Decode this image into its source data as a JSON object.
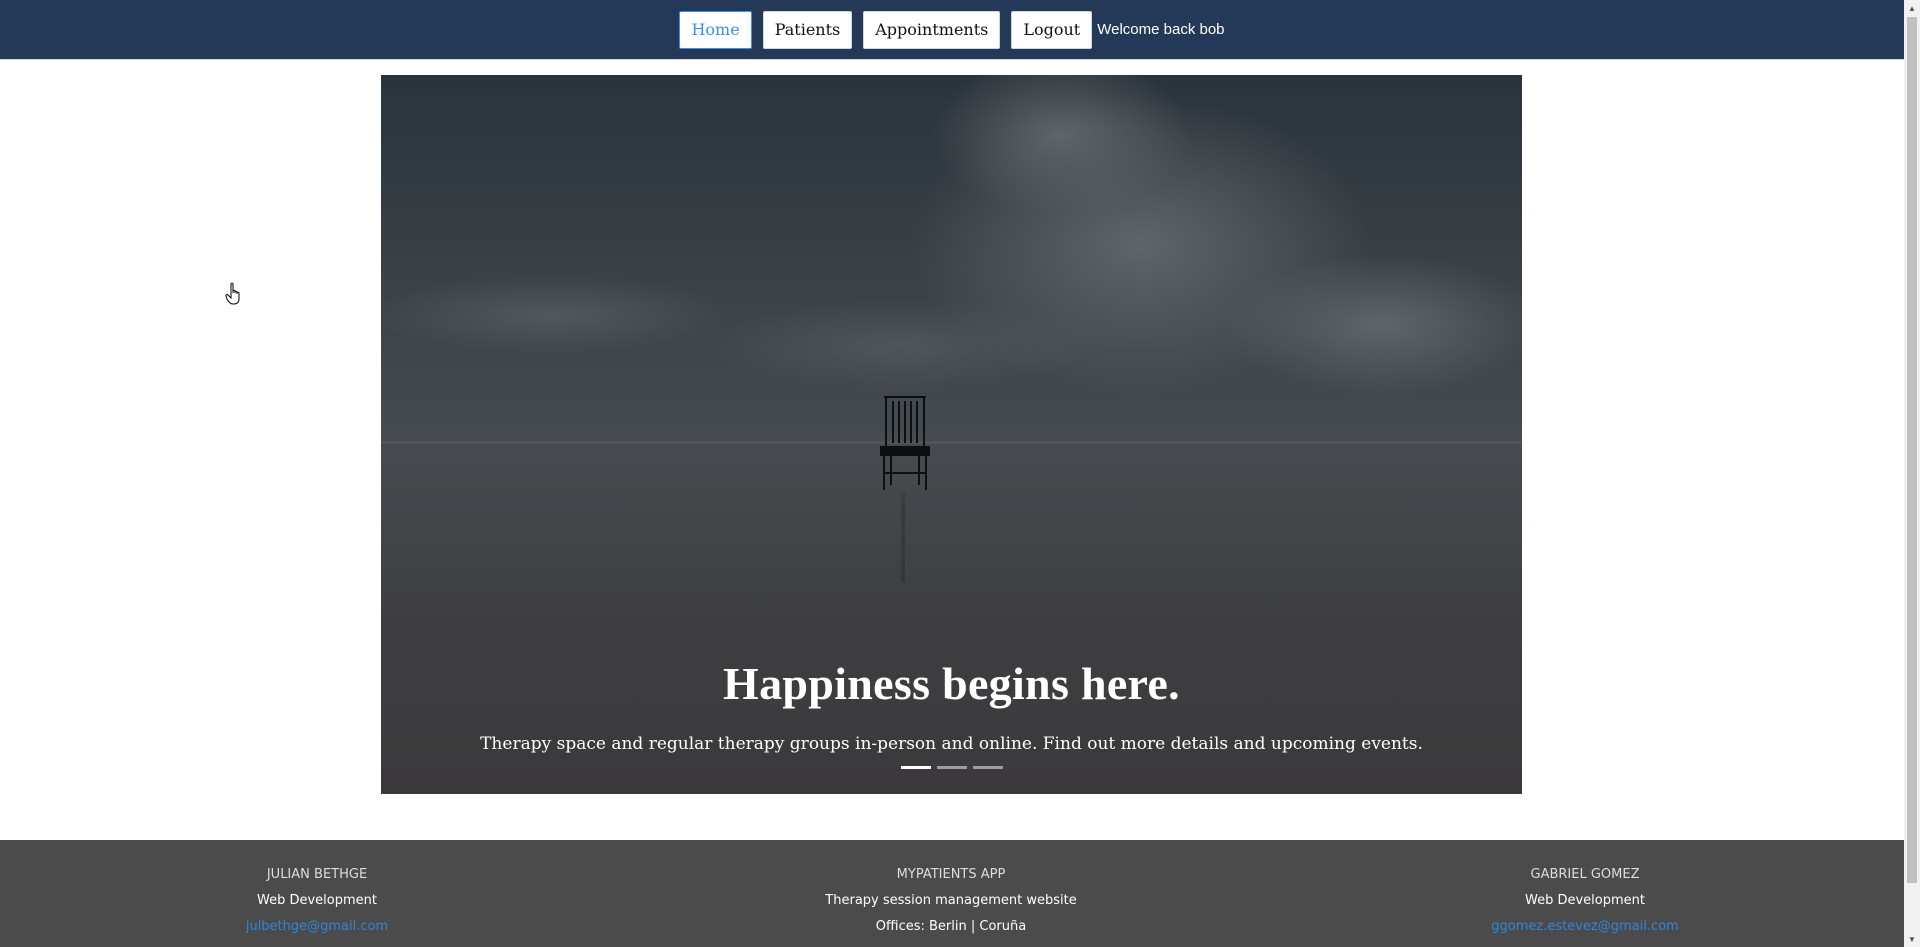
{
  "nav": {
    "home_label": "Home",
    "patients_label": "Patients",
    "appointments_label": "Appointments",
    "logout_label": "Logout",
    "welcome_text": "Welcome back bob",
    "active_color": "#3d8ef0",
    "bar_color": "#243858"
  },
  "hero": {
    "title": "Happiness begins here.",
    "subtitle": "Therapy space and regular therapy groups in-person and online. Find out more details and upcoming events.",
    "slide_count": 3,
    "active_slide": 1
  },
  "footer": {
    "left": {
      "heading": "JULIAN BETHGE",
      "role": "Web Development",
      "email": "julbethge@gmail.com"
    },
    "middle": {
      "heading": "MYPATIENTS APP",
      "description": "Therapy session management website",
      "offices": "Offices: Berlin | Coruña"
    },
    "right": {
      "heading": "GABRIEL GOMEZ",
      "role": "Web Development",
      "email": "ggomez.estevez@gmail.com"
    },
    "link_color": "#2f86d9"
  }
}
